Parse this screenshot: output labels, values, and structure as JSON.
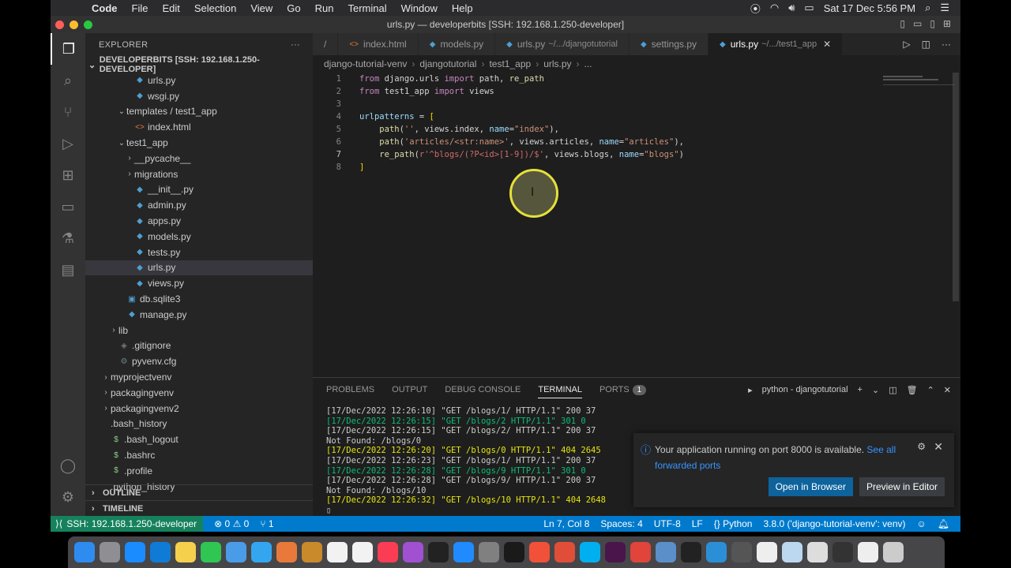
{
  "menubar": {
    "apple": "",
    "app": "Code",
    "items": [
      "File",
      "Edit",
      "Selection",
      "View",
      "Go",
      "Run",
      "Terminal",
      "Window",
      "Help"
    ],
    "datetime": "Sat 17 Dec  5:56 PM"
  },
  "window": {
    "title": "urls.py — developerbits [SSH: 192.168.1.250-developer]"
  },
  "sidebar": {
    "header": "EXPLORER",
    "more": "···",
    "root": "DEVELOPERBITS [SSH: 192.168.1.250-DEVELOPER]",
    "tree": [
      {
        "label": "urls.py",
        "icon": "py",
        "indent": 2,
        "chev": ""
      },
      {
        "label": "wsgi.py",
        "icon": "py",
        "indent": 2,
        "chev": ""
      },
      {
        "label": "templates / test1_app",
        "icon": "",
        "indent": 1,
        "chev": "⌄"
      },
      {
        "label": "index.html",
        "icon": "html",
        "indent": 2,
        "chev": ""
      },
      {
        "label": "test1_app",
        "icon": "",
        "indent": 1,
        "chev": "⌄"
      },
      {
        "label": "__pycache__",
        "icon": "",
        "indent": 2,
        "chev": "›"
      },
      {
        "label": "migrations",
        "icon": "",
        "indent": 2,
        "chev": "›"
      },
      {
        "label": "__init__.py",
        "icon": "py",
        "indent": 2,
        "chev": ""
      },
      {
        "label": "admin.py",
        "icon": "py",
        "indent": 2,
        "chev": ""
      },
      {
        "label": "apps.py",
        "icon": "py",
        "indent": 2,
        "chev": ""
      },
      {
        "label": "models.py",
        "icon": "py",
        "indent": 2,
        "chev": ""
      },
      {
        "label": "tests.py",
        "icon": "py",
        "indent": 2,
        "chev": ""
      },
      {
        "label": "urls.py",
        "icon": "py",
        "indent": 2,
        "chev": "",
        "selected": true
      },
      {
        "label": "views.py",
        "icon": "py",
        "indent": 2,
        "chev": ""
      },
      {
        "label": "db.sqlite3",
        "icon": "db",
        "indent": 1,
        "chev": ""
      },
      {
        "label": "manage.py",
        "icon": "py",
        "indent": 1,
        "chev": ""
      },
      {
        "label": "lib",
        "icon": "",
        "indent": 0,
        "chev": "›"
      },
      {
        "label": ".gitignore",
        "icon": "git",
        "indent": 0,
        "chev": ""
      },
      {
        "label": "pyvenv.cfg",
        "icon": "cfg",
        "indent": 0,
        "chev": ""
      },
      {
        "label": "myprojectvenv",
        "icon": "",
        "indent": -1,
        "chev": "›"
      },
      {
        "label": "packagingvenv",
        "icon": "",
        "indent": -1,
        "chev": "›"
      },
      {
        "label": "packagingvenv2",
        "icon": "",
        "indent": -1,
        "chev": "›"
      },
      {
        "label": ".bash_history",
        "icon": "",
        "indent": -1,
        "chev": ""
      },
      {
        "label": ".bash_logout",
        "icon": "sh",
        "indent": -1,
        "chev": ""
      },
      {
        "label": ".bashrc",
        "icon": "sh",
        "indent": -1,
        "chev": ""
      },
      {
        "label": ".profile",
        "icon": "sh",
        "indent": -1,
        "chev": ""
      },
      {
        "label": ".python_history",
        "icon": "",
        "indent": -1,
        "chev": ""
      }
    ],
    "outline": "OUTLINE",
    "timeline": "TIMELINE"
  },
  "tabs": [
    {
      "label": "/",
      "desc": "",
      "icon": "",
      "active": false
    },
    {
      "label": "index.html",
      "desc": "",
      "icon": "html",
      "active": false
    },
    {
      "label": "models.py",
      "desc": "",
      "icon": "py",
      "active": false
    },
    {
      "label": "urls.py",
      "desc": "~/.../djangotutorial",
      "icon": "py",
      "active": false
    },
    {
      "label": "settings.py",
      "desc": "",
      "icon": "py",
      "active": false
    },
    {
      "label": "urls.py",
      "desc": "~/.../test1_app",
      "icon": "py",
      "active": true
    }
  ],
  "breadcrumbs": [
    "django-tutorial-venv",
    "djangotutorial",
    "test1_app",
    "urls.py",
    "..."
  ],
  "editor": {
    "current_line": 7,
    "lines": [
      {
        "n": "1",
        "html": "<span class='kw'>from</span> django.urls <span class='kw'>import</span> path, <span class='fn'>re_path</span>"
      },
      {
        "n": "2",
        "html": "<span class='kw'>from</span> test1_app <span class='kw'>import</span> views"
      },
      {
        "n": "3",
        "html": ""
      },
      {
        "n": "4",
        "html": "<span class='var'>urlpatterns</span> = <span class='br'>[</span>"
      },
      {
        "n": "5",
        "html": "    <span class='fn'>path</span>(<span class='str'>''</span>, views.index, <span class='var'>name</span>=<span class='str'>\"index\"</span>),"
      },
      {
        "n": "6",
        "html": "    <span class='fn'>path</span>(<span class='str'>'articles/&lt;str:name&gt;'</span>, views.articles, <span class='var'>name</span>=<span class='str'>\"articles\"</span>),"
      },
      {
        "n": "7",
        "html": "    <span class='fn'>re_path</span>(<span class='reg'>r'^blogs/(?P&lt;id&gt;[1-9])/$'</span>, views.blogs, <span class='var'>name</span>=<span class='str'>\"blogs\"</span>)"
      },
      {
        "n": "8",
        "html": "<span class='br'>]</span>"
      }
    ]
  },
  "panel": {
    "tabs": [
      "PROBLEMS",
      "OUTPUT",
      "DEBUG CONSOLE",
      "TERMINAL",
      "PORTS"
    ],
    "active_tab": "TERMINAL",
    "ports_badge": "1",
    "terminal_name": "python - djangotutorial",
    "terminal_lines": [
      {
        "text": "[17/Dec/2022 12:26:10] \"GET /blogs/1/ HTTP/1.1\" 200 37",
        "cls": ""
      },
      {
        "text": "[17/Dec/2022 12:26:15] \"GET /blogs/2 HTTP/1.1\" 301 0",
        "cls": "green"
      },
      {
        "text": "[17/Dec/2022 12:26:15] \"GET /blogs/2/ HTTP/1.1\" 200 37",
        "cls": ""
      },
      {
        "text": "Not Found: /blogs/0",
        "cls": ""
      },
      {
        "text": "[17/Dec/2022 12:26:20] \"GET /blogs/0 HTTP/1.1\" 404 2645",
        "cls": "yellow"
      },
      {
        "text": "[17/Dec/2022 12:26:23] \"GET /blogs/1/ HTTP/1.1\" 200 37",
        "cls": ""
      },
      {
        "text": "[17/Dec/2022 12:26:28] \"GET /blogs/9 HTTP/1.1\" 301 0",
        "cls": "green"
      },
      {
        "text": "[17/Dec/2022 12:26:28] \"GET /blogs/9/ HTTP/1.1\" 200 37",
        "cls": ""
      },
      {
        "text": "Not Found: /blogs/10",
        "cls": ""
      },
      {
        "text": "[17/Dec/2022 12:26:32] \"GET /blogs/10 HTTP/1.1\" 404 2648",
        "cls": "yellow"
      },
      {
        "text": "▯",
        "cls": ""
      }
    ]
  },
  "notification": {
    "message": "Your application running on port 8000 is available.",
    "link": "See all forwarded ports",
    "primary_button": "Open in Browser",
    "secondary_button": "Preview in Editor"
  },
  "statusbar": {
    "remote": "SSH: 192.168.1.250-developer",
    "problems": "⊗ 0 ⚠ 0",
    "ports": "1",
    "position": "Ln 7, Col 8",
    "spaces": "Spaces: 4",
    "encoding": "UTF-8",
    "eol": "LF",
    "language": "Python",
    "interpreter": "3.8.0 ('django-tutorial-venv': venv)"
  },
  "dock": {
    "icons": [
      {
        "name": "finder",
        "color": "#2e8cf0"
      },
      {
        "name": "launchpad",
        "color": "#8e8e93"
      },
      {
        "name": "safari",
        "color": "#1a8cff"
      },
      {
        "name": "edge",
        "color": "#0f7bd6"
      },
      {
        "name": "notes",
        "color": "#f5d04c"
      },
      {
        "name": "facetime",
        "color": "#2fc653"
      },
      {
        "name": "preview",
        "color": "#4b9ce8"
      },
      {
        "name": "weather",
        "color": "#34a6f0"
      },
      {
        "name": "photos",
        "color": "#e8793a"
      },
      {
        "name": "books",
        "color": "#c98a2c"
      },
      {
        "name": "calendar",
        "color": "#f2f2f2"
      },
      {
        "name": "reminders",
        "color": "#f2f2f2"
      },
      {
        "name": "music",
        "color": "#fa3c55"
      },
      {
        "name": "podcasts",
        "color": "#a050d0"
      },
      {
        "name": "tv",
        "color": "#222222"
      },
      {
        "name": "appstore",
        "color": "#1f8bff"
      },
      {
        "name": "settings",
        "color": "#808080"
      },
      {
        "name": "terminal",
        "color": "#1a1a1a"
      },
      {
        "name": "swift",
        "color": "#f05138"
      },
      {
        "name": "git",
        "color": "#e04e39"
      },
      {
        "name": "skype",
        "color": "#00aff0"
      },
      {
        "name": "slack",
        "color": "#4a154b"
      },
      {
        "name": "chrome",
        "color": "#e0443a"
      },
      {
        "name": "virtualbox",
        "color": "#5b8fc9"
      },
      {
        "name": "activity",
        "color": "#222222"
      },
      {
        "name": "vscode",
        "color": "#2b8fd8"
      },
      {
        "name": "screenshot",
        "color": "#555555"
      },
      {
        "name": "textedit",
        "color": "#eeeeee"
      },
      {
        "name": "folder-1",
        "color": "#bcd8f0"
      },
      {
        "name": "folder-2",
        "color": "#dddddd"
      },
      {
        "name": "folder-3",
        "color": "#333333"
      },
      {
        "name": "folder-4",
        "color": "#eeeeee"
      },
      {
        "name": "trash",
        "color": "#cccccc"
      }
    ]
  }
}
